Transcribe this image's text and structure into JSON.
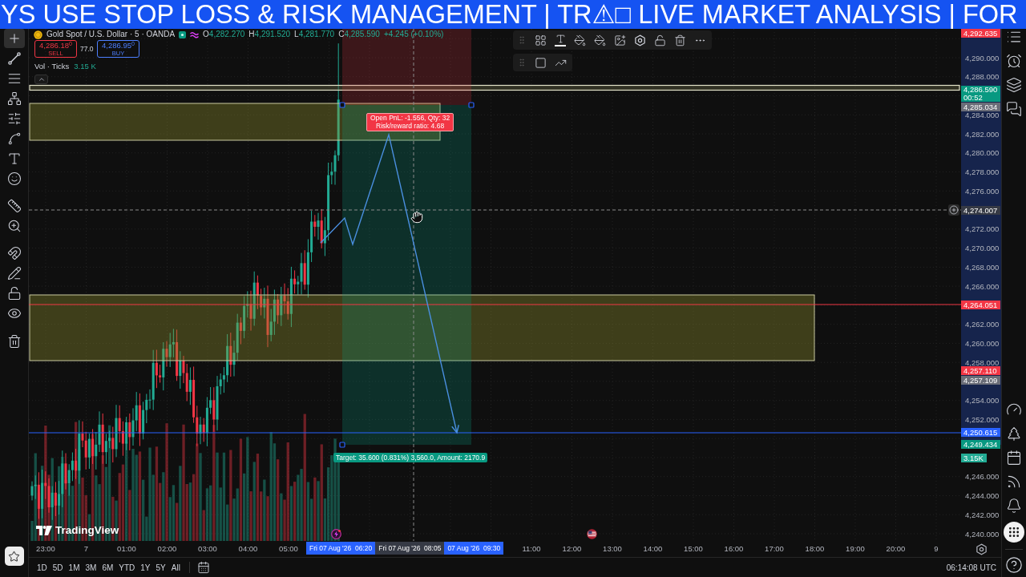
{
  "banner": {
    "text": "YS USE STOP LOSS & RISK MANAGEMENT | TR⚠□ LIVE MARKET ANALYSIS | FOR"
  },
  "left_toolbar": {
    "tools": [
      {
        "selected": true
      },
      {
        "selected": false
      },
      {
        "selected": false
      },
      {
        "selected": false
      },
      {
        "selected": false
      },
      {
        "selected": false
      },
      {
        "selected": false
      },
      {
        "selected": false
      },
      {
        "selected": false
      },
      {
        "selected": false
      },
      {
        "selected": false
      },
      {
        "selected": false
      },
      {
        "selected": false
      },
      {
        "selected": false
      },
      {
        "selected": false
      }
    ]
  },
  "chart": {
    "symbol": "Gold Spot / U.S. Dollar · 5 · OANDA",
    "ohlc": [
      {
        "label": "O",
        "value": "4,282.270"
      },
      {
        "label": "H",
        "value": "4,291.520"
      },
      {
        "label": "L",
        "value": "4,281.770"
      },
      {
        "label": "C",
        "value": "4,285.590"
      }
    ],
    "change": "+4.245 (+0.10%)",
    "sell": {
      "price": "4,286.18$^{0}$",
      "label": "SELL"
    },
    "spread": "77.0",
    "buy": {
      "price": "4,286.95$^{0}$",
      "label": "BUY"
    },
    "volume_legend": {
      "label": "Vol · Ticks",
      "value": "3.15 K"
    },
    "position": {
      "pnl_lines": [
        "Open PnL: -1.556, Qty: 32",
        "Risk/reward ratio: 4.68"
      ],
      "target_label": "Target: 35.600 (0.831%) 3,560.0, Amount: 2170.9"
    },
    "logo_text": "TradingView"
  },
  "price_axis": {
    "ticks": [
      "4,290.000",
      "4,288.000",
      "4,284.000",
      "4,282.000",
      "4,280.000",
      "4,278.000",
      "4,276.000",
      "4,272.000",
      "4,270.000",
      "4,268.000",
      "4,266.000",
      "4,262.000",
      "4,260.000",
      "4,258.000",
      "4,254.000",
      "4,252.000",
      "4,246.000",
      "4,244.000",
      "4,242.000",
      "4,240.000"
    ],
    "tags": [
      {
        "text": "4,292.635",
        "color": "#f23645"
      },
      {
        "text": "4,286.590",
        "countdown": "00:52",
        "color": "#089981"
      },
      {
        "text": "4,285.034",
        "color": "#6a6d78"
      },
      {
        "text": "4,274.007",
        "color": "#363a45"
      },
      {
        "text": "4,264.051",
        "color": "#f23645"
      },
      {
        "text": "4,257.110",
        "color": "#f23645"
      },
      {
        "text": "4,257.109",
        "color": "#6a6d78"
      },
      {
        "text": "4,250.615",
        "color": "#2962ff"
      },
      {
        "text": "4,249.434",
        "color": "#089981"
      },
      {
        "text": "3.15K",
        "color": "#22ab94"
      }
    ]
  },
  "time_axis": {
    "ticks": [
      "23:00",
      "7",
      "01:00",
      "02:00",
      "03:00",
      "04:00",
      "05:00",
      "11:00",
      "12:00",
      "13:00",
      "14:00",
      "15:00",
      "16:00",
      "17:00",
      "18:00",
      "19:00",
      "20:00",
      "9"
    ],
    "markers": [
      {
        "text": "Fri 07 Aug '26  06:20",
        "color": "#2962ff"
      },
      {
        "text": "Fri 07 Aug '26  08:05",
        "color": "#363a45"
      },
      {
        "text": "07 Aug '26  09:30",
        "color": "#2962ff"
      }
    ]
  },
  "bottom_bar": {
    "timeframes": [
      "1D",
      "5D",
      "1M",
      "3M",
      "6M",
      "YTD",
      "1Y",
      "5Y",
      "All"
    ],
    "clock": "06:14:08 UTC"
  }
}
